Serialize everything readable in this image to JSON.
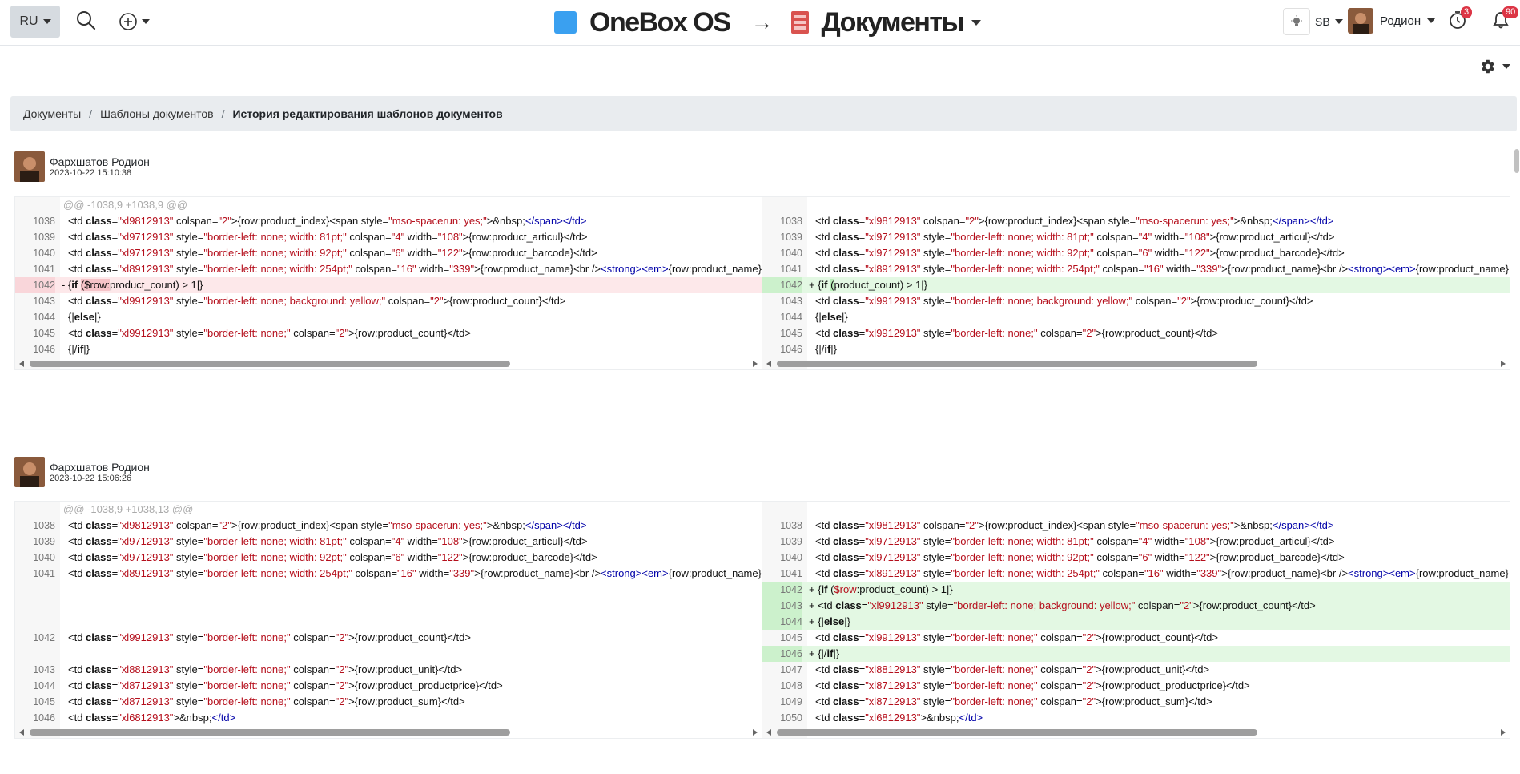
{
  "header": {
    "lang": "RU",
    "brand": "OneBox OS",
    "arrow": "→",
    "module": "Документы",
    "sb_label": "SB",
    "user_name": "Родион",
    "timer_badge": "3",
    "bell_badge": "90"
  },
  "colors": {
    "brand_logo": "#3aa0f0",
    "doc_icon": "#d9534f",
    "badge": "#dc3545",
    "del_bg": "#fde8ea",
    "add_bg": "#e3f8e3"
  },
  "breadcrumb": {
    "items": [
      "Документы",
      "Шаблоны документов"
    ],
    "active": "История редактирования шаблонов документов"
  },
  "revisions": [
    {
      "author": "Фархшатов Родион",
      "date": "2023-10-22 15:10:38",
      "hunk": "@@ -1038,9 +1038,9 @@",
      "left": [
        {
          "type": "ctx",
          "ln": "1038",
          "html": "&lt;td <span class=\"k\">class</span>=<span class=\"s\">\"xl9812913\"</span> colspan=<span class=\"s\">\"2\"</span>&gt;{row:product_index}&lt;span style=<span class=\"s\">\"mso-spacerun: yes;\"</span>&gt;&amp;nbsp;<span class=\"t\">&lt;/span&gt;&lt;/td&gt;</span>"
        },
        {
          "type": "ctx",
          "ln": "1039",
          "html": "&lt;td <span class=\"k\">class</span>=<span class=\"s\">\"xl9712913\"</span> style=<span class=\"s\">\"border-left: none; width: 81pt;\"</span> colspan=<span class=\"s\">\"4\"</span> width=<span class=\"s\">\"108\"</span>&gt;{row:product_articul}&lt;/td&gt;"
        },
        {
          "type": "ctx",
          "ln": "1040",
          "html": "&lt;td <span class=\"k\">class</span>=<span class=\"s\">\"xl9712913\"</span> style=<span class=\"s\">\"border-left: none; width: 92pt;\"</span> colspan=<span class=\"s\">\"6\"</span> width=<span class=\"s\">\"122\"</span>&gt;{row:product_barcode}&lt;/td&gt;"
        },
        {
          "type": "ctx",
          "ln": "1041",
          "html": "&lt;td <span class=\"k\">class</span>=<span class=\"s\">\"xl8912913\"</span> style=<span class=\"s\">\"border-left: none; width: 254pt;\"</span> colspan=<span class=\"s\">\"16\"</span> width=<span class=\"s\">\"339\"</span>&gt;{row:product_name}&lt;br /&gt;<span class=\"t\">&lt;strong&gt;&lt;em&gt;</span>{row:product_name}"
        },
        {
          "type": "del",
          "ln": "1042",
          "html": "- {<span class=\"k\">if</span> <span class=\"hl-del\">($row:</span>product_count) &gt; 1|}"
        },
        {
          "type": "ctx",
          "ln": "1043",
          "html": "&lt;td <span class=\"k\">class</span>=<span class=\"s\">\"xl9912913\"</span> style=<span class=\"s\">\"border-left: none; background: yellow;\"</span> colspan=<span class=\"s\">\"2\"</span>&gt;{row:product_count}&lt;/td&gt;"
        },
        {
          "type": "ctx",
          "ln": "1044",
          "html": "{|<span class=\"k\">else</span>|}"
        },
        {
          "type": "ctx",
          "ln": "1045",
          "html": "&lt;td <span class=\"k\">class</span>=<span class=\"s\">\"xl9912913\"</span> style=<span class=\"s\">\"border-left: none;\"</span> colspan=<span class=\"s\">\"2\"</span>&gt;{row:product_count}&lt;/td&gt;"
        },
        {
          "type": "ctx",
          "ln": "1046",
          "html": "{|/<span class=\"k\">if</span>|}"
        }
      ],
      "right": [
        {
          "type": "ctx",
          "ln": "1038",
          "html": "&lt;td <span class=\"k\">class</span>=<span class=\"s\">\"xl9812913\"</span> colspan=<span class=\"s\">\"2\"</span>&gt;{row:product_index}&lt;span style=<span class=\"s\">\"mso-spacerun: yes;\"</span>&gt;&amp;nbsp;<span class=\"t\">&lt;/span&gt;&lt;/td&gt;</span>"
        },
        {
          "type": "ctx",
          "ln": "1039",
          "html": "&lt;td <span class=\"k\">class</span>=<span class=\"s\">\"xl9712913\"</span> style=<span class=\"s\">\"border-left: none; width: 81pt;\"</span> colspan=<span class=\"s\">\"4\"</span> width=<span class=\"s\">\"108\"</span>&gt;{row:product_articul}&lt;/td&gt;"
        },
        {
          "type": "ctx",
          "ln": "1040",
          "html": "&lt;td <span class=\"k\">class</span>=<span class=\"s\">\"xl9712913\"</span> style=<span class=\"s\">\"border-left: none; width: 92pt;\"</span> colspan=<span class=\"s\">\"6\"</span> width=<span class=\"s\">\"122\"</span>&gt;{row:product_barcode}&lt;/td&gt;"
        },
        {
          "type": "ctx",
          "ln": "1041",
          "html": "&lt;td <span class=\"k\">class</span>=<span class=\"s\">\"xl8912913\"</span> style=<span class=\"s\">\"border-left: none; width: 254pt;\"</span> colspan=<span class=\"s\">\"16\"</span> width=<span class=\"s\">\"339\"</span>&gt;{row:product_name}&lt;br /&gt;<span class=\"t\">&lt;strong&gt;&lt;em&gt;</span>{row:product_name}"
        },
        {
          "type": "add",
          "ln": "1042",
          "html": "+ {<span class=\"k\">if</span> <span class=\"hl-add\">(</span>product_count) &gt; 1|}"
        },
        {
          "type": "ctx",
          "ln": "1043",
          "html": "&lt;td <span class=\"k\">class</span>=<span class=\"s\">\"xl9912913\"</span> style=<span class=\"s\">\"border-left: none; background: yellow;\"</span> colspan=<span class=\"s\">\"2\"</span>&gt;{row:product_count}&lt;/td&gt;"
        },
        {
          "type": "ctx",
          "ln": "1044",
          "html": "{|<span class=\"k\">else</span>|}"
        },
        {
          "type": "ctx",
          "ln": "1045",
          "html": "&lt;td <span class=\"k\">class</span>=<span class=\"s\">\"xl9912913\"</span> style=<span class=\"s\">\"border-left: none;\"</span> colspan=<span class=\"s\">\"2\"</span>&gt;{row:product_count}&lt;/td&gt;"
        },
        {
          "type": "ctx",
          "ln": "1046",
          "html": "{|/<span class=\"k\">if</span>|}"
        }
      ]
    },
    {
      "author": "Фархшатов Родион",
      "date": "2023-10-22 15:06:26",
      "hunk": "@@ -1038,9 +1038,13 @@",
      "left": [
        {
          "type": "ctx",
          "ln": "1038",
          "html": "&lt;td <span class=\"k\">class</span>=<span class=\"s\">\"xl9812913\"</span> colspan=<span class=\"s\">\"2\"</span>&gt;{row:product_index}&lt;span style=<span class=\"s\">\"mso-spacerun: yes;\"</span>&gt;&amp;nbsp;<span class=\"t\">&lt;/span&gt;&lt;/td&gt;</span>"
        },
        {
          "type": "ctx",
          "ln": "1039",
          "html": "&lt;td <span class=\"k\">class</span>=<span class=\"s\">\"xl9712913\"</span> style=<span class=\"s\">\"border-left: none; width: 81pt;\"</span> colspan=<span class=\"s\">\"4\"</span> width=<span class=\"s\">\"108\"</span>&gt;{row:product_articul}&lt;/td&gt;"
        },
        {
          "type": "ctx",
          "ln": "1040",
          "html": "&lt;td <span class=\"k\">class</span>=<span class=\"s\">\"xl9712913\"</span> style=<span class=\"s\">\"border-left: none; width: 92pt;\"</span> colspan=<span class=\"s\">\"6\"</span> width=<span class=\"s\">\"122\"</span>&gt;{row:product_barcode}&lt;/td&gt;"
        },
        {
          "type": "ctx",
          "ln": "1041",
          "html": "&lt;td <span class=\"k\">class</span>=<span class=\"s\">\"xl8912913\"</span> style=<span class=\"s\">\"border-left: none; width: 254pt;\"</span> colspan=<span class=\"s\">\"16\"</span> width=<span class=\"s\">\"339\"</span>&gt;{row:product_name}&lt;br /&gt;<span class=\"t\">&lt;strong&gt;&lt;em&gt;</span>{row:product_name}"
        },
        {
          "type": "empty",
          "ln": "",
          "html": ""
        },
        {
          "type": "empty",
          "ln": "",
          "html": ""
        },
        {
          "type": "empty",
          "ln": "",
          "html": ""
        },
        {
          "type": "ctx",
          "ln": "1042",
          "html": "&lt;td <span class=\"k\">class</span>=<span class=\"s\">\"xl9912913\"</span> style=<span class=\"s\">\"border-left: none;\"</span> colspan=<span class=\"s\">\"2\"</span>&gt;{row:product_count}&lt;/td&gt;"
        },
        {
          "type": "empty",
          "ln": "",
          "html": ""
        },
        {
          "type": "ctx",
          "ln": "1043",
          "html": "&lt;td <span class=\"k\">class</span>=<span class=\"s\">\"xl8812913\"</span> style=<span class=\"s\">\"border-left: none;\"</span> colspan=<span class=\"s\">\"2\"</span>&gt;{row:product_unit}&lt;/td&gt;"
        },
        {
          "type": "ctx",
          "ln": "1044",
          "html": "&lt;td <span class=\"k\">class</span>=<span class=\"s\">\"xl8712913\"</span> style=<span class=\"s\">\"border-left: none;\"</span> colspan=<span class=\"s\">\"2\"</span>&gt;{row:product_productprice}&lt;/td&gt;"
        },
        {
          "type": "ctx",
          "ln": "1045",
          "html": "&lt;td <span class=\"k\">class</span>=<span class=\"s\">\"xl8712913\"</span> style=<span class=\"s\">\"border-left: none;\"</span> colspan=<span class=\"s\">\"2\"</span>&gt;{row:product_sum}&lt;/td&gt;"
        },
        {
          "type": "ctx",
          "ln": "1046",
          "html": "&lt;td <span class=\"k\">class</span>=<span class=\"s\">\"xl6812913\"</span>&gt;&amp;nbsp;<span class=\"t\">&lt;/td&gt;</span>"
        }
      ],
      "right": [
        {
          "type": "ctx",
          "ln": "1038",
          "html": "&lt;td <span class=\"k\">class</span>=<span class=\"s\">\"xl9812913\"</span> colspan=<span class=\"s\">\"2\"</span>&gt;{row:product_index}&lt;span style=<span class=\"s\">\"mso-spacerun: yes;\"</span>&gt;&amp;nbsp;<span class=\"t\">&lt;/span&gt;&lt;/td&gt;</span>"
        },
        {
          "type": "ctx",
          "ln": "1039",
          "html": "&lt;td <span class=\"k\">class</span>=<span class=\"s\">\"xl9712913\"</span> style=<span class=\"s\">\"border-left: none; width: 81pt;\"</span> colspan=<span class=\"s\">\"4\"</span> width=<span class=\"s\">\"108\"</span>&gt;{row:product_articul}&lt;/td&gt;"
        },
        {
          "type": "ctx",
          "ln": "1040",
          "html": "&lt;td <span class=\"k\">class</span>=<span class=\"s\">\"xl9712913\"</span> style=<span class=\"s\">\"border-left: none; width: 92pt;\"</span> colspan=<span class=\"s\">\"6\"</span> width=<span class=\"s\">\"122\"</span>&gt;{row:product_barcode}&lt;/td&gt;"
        },
        {
          "type": "ctx",
          "ln": "1041",
          "html": "&lt;td <span class=\"k\">class</span>=<span class=\"s\">\"xl8912913\"</span> style=<span class=\"s\">\"border-left: none; width: 254pt;\"</span> colspan=<span class=\"s\">\"16\"</span> width=<span class=\"s\">\"339\"</span>&gt;{row:product_name}&lt;br /&gt;<span class=\"t\">&lt;strong&gt;&lt;em&gt;</span>{row:product_name}"
        },
        {
          "type": "add",
          "ln": "1042",
          "html": "+ {<span class=\"k\">if</span> (<span class=\"s\">$row</span>:product_count) &gt; 1|}"
        },
        {
          "type": "add",
          "ln": "1043",
          "html": "+ &lt;td <span class=\"k\">class</span>=<span class=\"s\">\"xl9912913\"</span> style=<span class=\"s\">\"border-left: none; background: yellow;\"</span> colspan=<span class=\"s\">\"2\"</span>&gt;{row:product_count}&lt;/td&gt;"
        },
        {
          "type": "add",
          "ln": "1044",
          "html": "+ {|<span class=\"k\">else</span>|}"
        },
        {
          "type": "ctx",
          "ln": "1045",
          "html": "&lt;td <span class=\"k\">class</span>=<span class=\"s\">\"xl9912913\"</span> style=<span class=\"s\">\"border-left: none;\"</span> colspan=<span class=\"s\">\"2\"</span>&gt;{row:product_count}&lt;/td&gt;"
        },
        {
          "type": "add",
          "ln": "1046",
          "html": "+ {|/<span class=\"k\">if</span>|}"
        },
        {
          "type": "ctx",
          "ln": "1047",
          "html": "&lt;td <span class=\"k\">class</span>=<span class=\"s\">\"xl8812913\"</span> style=<span class=\"s\">\"border-left: none;\"</span> colspan=<span class=\"s\">\"2\"</span>&gt;{row:product_unit}&lt;/td&gt;"
        },
        {
          "type": "ctx",
          "ln": "1048",
          "html": "&lt;td <span class=\"k\">class</span>=<span class=\"s\">\"xl8712913\"</span> style=<span class=\"s\">\"border-left: none;\"</span> colspan=<span class=\"s\">\"2\"</span>&gt;{row:product_productprice}&lt;/td&gt;"
        },
        {
          "type": "ctx",
          "ln": "1049",
          "html": "&lt;td <span class=\"k\">class</span>=<span class=\"s\">\"xl8712913\"</span> style=<span class=\"s\">\"border-left: none;\"</span> colspan=<span class=\"s\">\"2\"</span>&gt;{row:product_sum}&lt;/td&gt;"
        },
        {
          "type": "ctx",
          "ln": "1050",
          "html": "&lt;td <span class=\"k\">class</span>=<span class=\"s\">\"xl6812913\"</span>&gt;&amp;nbsp;<span class=\"t\">&lt;/td&gt;</span>"
        }
      ]
    }
  ]
}
